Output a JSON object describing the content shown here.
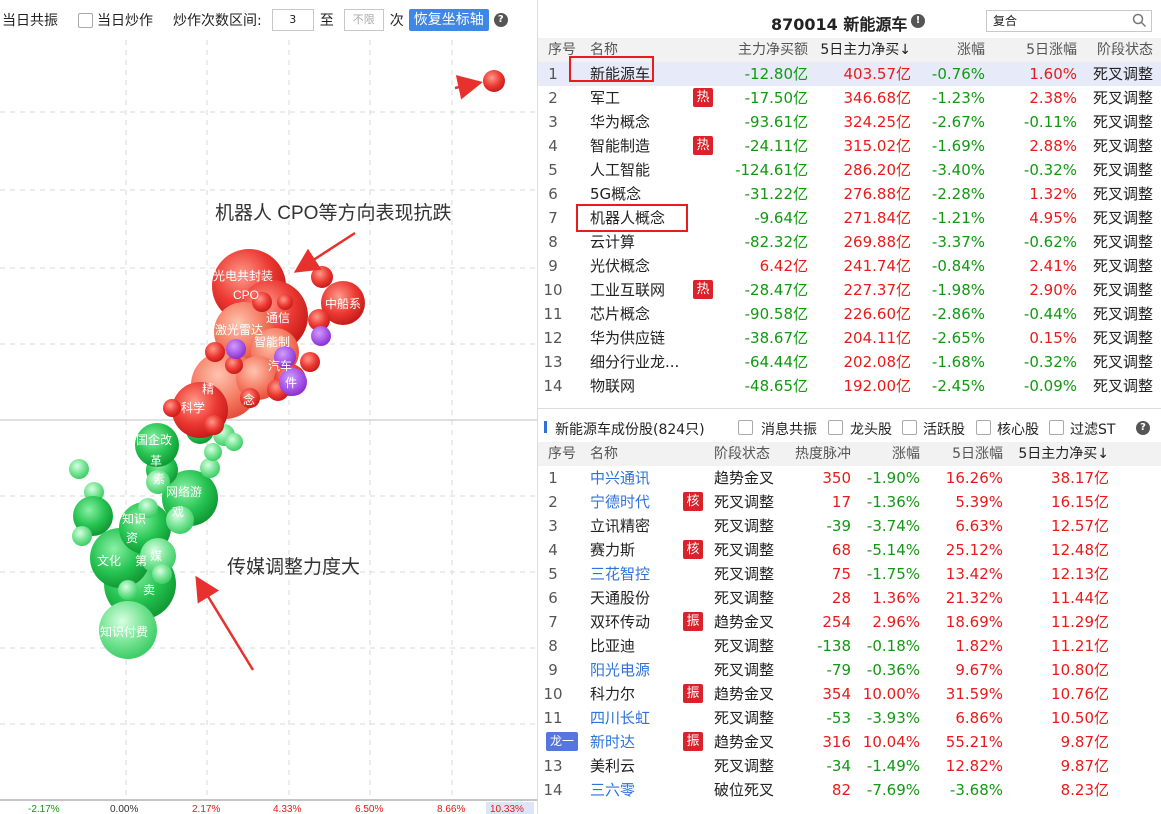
{
  "toolbar": {
    "same_day_resonance": "当日共振",
    "same_day_hype": "当日炒作",
    "hype_range_label": "炒作次数区间:",
    "range_from": "3",
    "range_to_word": "至",
    "range_to_placeholder": "不限",
    "times_word": "次",
    "restore_axis": "恢复坐标轴"
  },
  "plot": {
    "x_ticks": [
      "-2.17%",
      "0.00%",
      "2.17%",
      "4.33%",
      "6.50%",
      "8.66%",
      "10.33%"
    ],
    "annotation_top": "机器人  CPO等方向表现抗跌",
    "annotation_bottom": "传媒调整力度大",
    "bubble_labels": [
      "光电共封装",
      "中船系",
      "激光雷达",
      "智能制",
      "汽车",
      "件",
      "精",
      "科学",
      "CPO",
      "通信",
      "念",
      "国企改",
      "革",
      "素",
      "网络游",
      "戏",
      "知识",
      "媒",
      "文化",
      "知识付费",
      "卖",
      "第",
      "资"
    ],
    "colors": {
      "red": "#e8302e",
      "green": "#1bbf4a",
      "purple": "#9b3fe0"
    }
  },
  "top": {
    "title": "870014 新能源车",
    "search_value": "复合",
    "headers": [
      "序号",
      "名称",
      "主力净买额",
      "5日主力净买↓",
      "涨幅",
      "5日涨幅",
      "阶段状态"
    ],
    "rows": [
      {
        "idx": "1",
        "name": "新能源车",
        "hot": "",
        "net": "-12.80亿",
        "net5": "403.57亿",
        "chg": "-0.76%",
        "chg5": "1.60%",
        "state": "死叉调整"
      },
      {
        "idx": "2",
        "name": "军工",
        "hot": "热",
        "net": "-17.50亿",
        "net5": "346.68亿",
        "chg": "-1.23%",
        "chg5": "2.38%",
        "state": "死叉调整"
      },
      {
        "idx": "3",
        "name": "华为概念",
        "hot": "",
        "net": "-93.61亿",
        "net5": "324.25亿",
        "chg": "-2.67%",
        "chg5": "-0.11%",
        "state": "死叉调整"
      },
      {
        "idx": "4",
        "name": "智能制造",
        "hot": "热",
        "net": "-24.11亿",
        "net5": "315.02亿",
        "chg": "-1.69%",
        "chg5": "2.88%",
        "state": "死叉调整"
      },
      {
        "idx": "5",
        "name": "人工智能",
        "hot": "",
        "net": "-124.61亿",
        "net5": "286.20亿",
        "chg": "-3.40%",
        "chg5": "-0.32%",
        "state": "死叉调整"
      },
      {
        "idx": "6",
        "name": "5G概念",
        "hot": "",
        "net": "-31.22亿",
        "net5": "276.88亿",
        "chg": "-2.28%",
        "chg5": "1.32%",
        "state": "死叉调整"
      },
      {
        "idx": "7",
        "name": "机器人概念",
        "hot": "",
        "net": "-9.64亿",
        "net5": "271.84亿",
        "chg": "-1.21%",
        "chg5": "4.95%",
        "state": "死叉调整"
      },
      {
        "idx": "8",
        "name": "云计算",
        "hot": "",
        "net": "-82.32亿",
        "net5": "269.88亿",
        "chg": "-3.37%",
        "chg5": "-0.62%",
        "state": "死叉调整"
      },
      {
        "idx": "9",
        "name": "光伏概念",
        "hot": "",
        "net": "6.42亿",
        "net5": "241.74亿",
        "chg": "-0.84%",
        "chg5": "2.41%",
        "state": "死叉调整"
      },
      {
        "idx": "10",
        "name": "工业互联网",
        "hot": "热",
        "net": "-28.47亿",
        "net5": "227.37亿",
        "chg": "-1.98%",
        "chg5": "2.90%",
        "state": "死叉调整"
      },
      {
        "idx": "11",
        "name": "芯片概念",
        "hot": "",
        "net": "-90.58亿",
        "net5": "226.60亿",
        "chg": "-2.86%",
        "chg5": "-0.44%",
        "state": "死叉调整"
      },
      {
        "idx": "12",
        "name": "华为供应链",
        "hot": "",
        "net": "-38.67亿",
        "net5": "204.11亿",
        "chg": "-2.65%",
        "chg5": "0.15%",
        "state": "死叉调整"
      },
      {
        "idx": "13",
        "name": "细分行业龙...",
        "hot": "",
        "net": "-64.44亿",
        "net5": "202.08亿",
        "chg": "-1.68%",
        "chg5": "-0.32%",
        "state": "死叉调整"
      },
      {
        "idx": "14",
        "name": "物联网",
        "hot": "",
        "net": "-48.65亿",
        "net5": "192.00亿",
        "chg": "-2.45%",
        "chg5": "-0.09%",
        "state": "死叉调整"
      }
    ]
  },
  "bottom": {
    "title": "新能源车成份股(824只)",
    "filters": [
      "消息共振",
      "龙头股",
      "活跃股",
      "核心股",
      "过滤ST"
    ],
    "headers": [
      "序号",
      "名称",
      "阶段状态",
      "热度脉冲",
      "涨幅",
      "5日涨幅",
      "5日主力净买↓"
    ],
    "rows": [
      {
        "idx": "1",
        "name": "中兴通讯",
        "blue": true,
        "tag": "",
        "state": "趋势金叉",
        "heat": "350",
        "chg": "-1.90%",
        "chg5": "16.26%",
        "net5": "38.17亿"
      },
      {
        "idx": "2",
        "name": "宁德时代",
        "blue": true,
        "tag": "核",
        "state": "死叉调整",
        "heat": "17",
        "chg": "-1.36%",
        "chg5": "5.39%",
        "net5": "16.15亿"
      },
      {
        "idx": "3",
        "name": "立讯精密",
        "blue": false,
        "tag": "",
        "state": "死叉调整",
        "heat": "-39",
        "chg": "-3.74%",
        "chg5": "6.63%",
        "net5": "12.57亿"
      },
      {
        "idx": "4",
        "name": "赛力斯",
        "blue": false,
        "tag": "核",
        "state": "死叉调整",
        "heat": "68",
        "chg": "-5.14%",
        "chg5": "25.12%",
        "net5": "12.48亿"
      },
      {
        "idx": "5",
        "name": "三花智控",
        "blue": true,
        "tag": "",
        "state": "死叉调整",
        "heat": "75",
        "chg": "-1.75%",
        "chg5": "13.42%",
        "net5": "12.13亿"
      },
      {
        "idx": "6",
        "name": "天通股份",
        "blue": false,
        "tag": "",
        "state": "死叉调整",
        "heat": "28",
        "chg": "1.36%",
        "chg5": "21.32%",
        "net5": "11.44亿"
      },
      {
        "idx": "7",
        "name": "双环传动",
        "blue": false,
        "tag": "振",
        "state": "趋势金叉",
        "heat": "254",
        "chg": "2.96%",
        "chg5": "18.69%",
        "net5": "11.29亿"
      },
      {
        "idx": "8",
        "name": "比亚迪",
        "blue": false,
        "tag": "",
        "state": "死叉调整",
        "heat": "-138",
        "chg": "-0.18%",
        "chg5": "1.82%",
        "net5": "11.21亿"
      },
      {
        "idx": "9",
        "name": "阳光电源",
        "blue": true,
        "tag": "",
        "state": "死叉调整",
        "heat": "-79",
        "chg": "-0.36%",
        "chg5": "9.67%",
        "net5": "10.80亿"
      },
      {
        "idx": "10",
        "name": "科力尔",
        "blue": false,
        "tag": "振",
        "state": "趋势金叉",
        "heat": "354",
        "chg": "10.00%",
        "chg5": "31.59%",
        "net5": "10.76亿"
      },
      {
        "idx": "11",
        "name": "四川长虹",
        "blue": true,
        "tag": "",
        "state": "死叉调整",
        "heat": "-53",
        "chg": "-3.93%",
        "chg5": "6.86%",
        "net5": "10.50亿"
      },
      {
        "idx": "龙一",
        "name": "新时达",
        "blue": true,
        "tag": "振",
        "state": "趋势金叉",
        "heat": "316",
        "chg": "10.04%",
        "chg5": "55.21%",
        "net5": "9.87亿"
      },
      {
        "idx": "13",
        "name": "美利云",
        "blue": false,
        "tag": "",
        "state": "死叉调整",
        "heat": "-34",
        "chg": "-1.49%",
        "chg5": "12.82%",
        "net5": "9.87亿"
      },
      {
        "idx": "14",
        "name": "三六零",
        "blue": true,
        "tag": "",
        "state": "破位死叉",
        "heat": "82",
        "chg": "-7.69%",
        "chg5": "-3.68%",
        "net5": "8.23亿"
      }
    ]
  }
}
